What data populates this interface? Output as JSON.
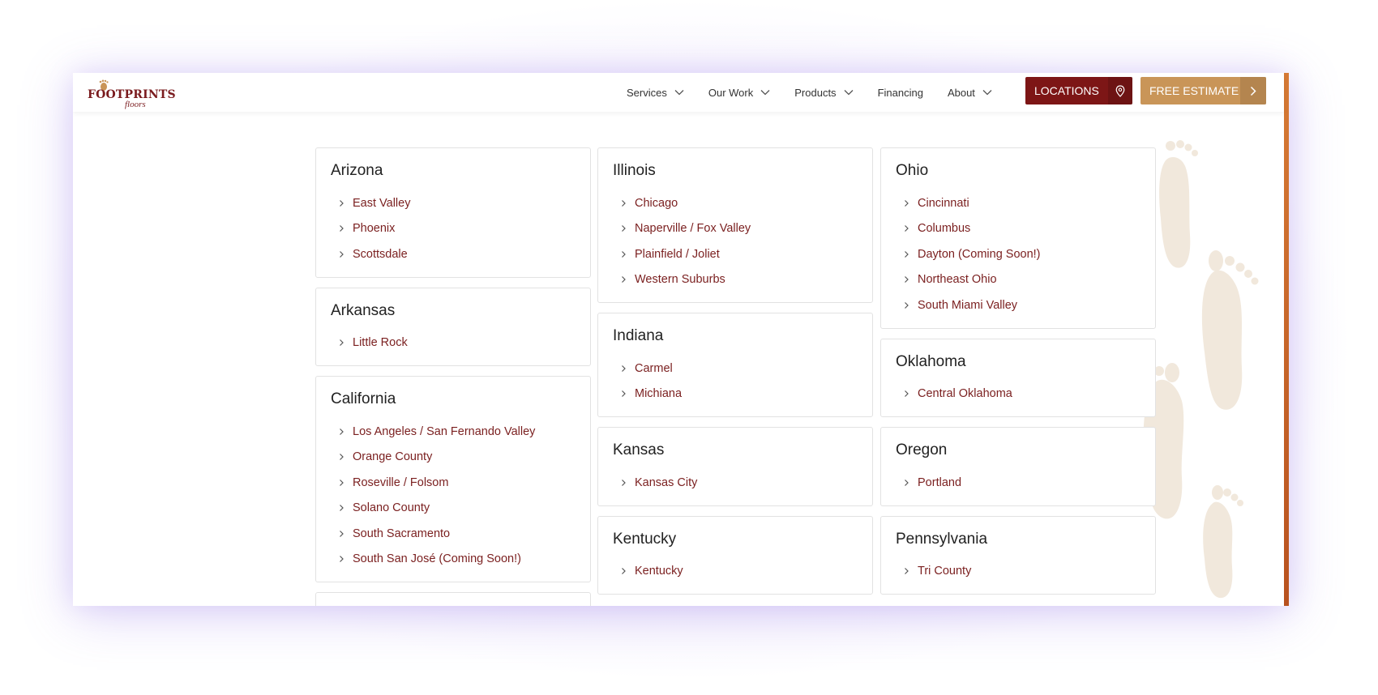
{
  "brand": {
    "logo_main": "FOOTPRINTS",
    "logo_sub": "floors",
    "primary_color": "#7d1616",
    "accent_color": "#c99558"
  },
  "nav": {
    "items": [
      {
        "label": "Services",
        "dropdown": true
      },
      {
        "label": "Our Work",
        "dropdown": true
      },
      {
        "label": "Products",
        "dropdown": true
      },
      {
        "label": "Financing",
        "dropdown": false
      },
      {
        "label": "About",
        "dropdown": true
      }
    ],
    "locations_label": "LOCATIONS",
    "locations_icon": "map-pin-icon",
    "estimate_label": "FREE ESTIMATE",
    "estimate_icon": "chevron-right-icon"
  },
  "columns": [
    [
      {
        "state": "Arizona",
        "cities": [
          "East Valley",
          "Phoenix",
          "Scottsdale"
        ]
      },
      {
        "state": "Arkansas",
        "cities": [
          "Little Rock"
        ]
      },
      {
        "state": "California",
        "cities": [
          "Los Angeles / San Fernando Valley",
          "Orange County",
          "Roseville / Folsom",
          "Solano County",
          "South Sacramento",
          "South San José (Coming Soon!)"
        ]
      },
      {
        "state": "",
        "cities": []
      }
    ],
    [
      {
        "state": "Illinois",
        "cities": [
          "Chicago",
          "Naperville / Fox Valley",
          "Plainfield / Joliet",
          "Western Suburbs"
        ]
      },
      {
        "state": "Indiana",
        "cities": [
          "Carmel",
          "Michiana"
        ]
      },
      {
        "state": "Kansas",
        "cities": [
          "Kansas City"
        ]
      },
      {
        "state": "Kentucky",
        "cities": [
          "Kentucky"
        ]
      }
    ],
    [
      {
        "state": "Ohio",
        "cities": [
          "Cincinnati",
          "Columbus",
          "Dayton (Coming Soon!)",
          "Northeast Ohio",
          "South Miami Valley"
        ]
      },
      {
        "state": "Oklahoma",
        "cities": [
          "Central Oklahoma"
        ]
      },
      {
        "state": "Oregon",
        "cities": [
          "Portland"
        ]
      },
      {
        "state": "Pennsylvania",
        "cities": [
          "Tri County"
        ]
      }
    ]
  ]
}
